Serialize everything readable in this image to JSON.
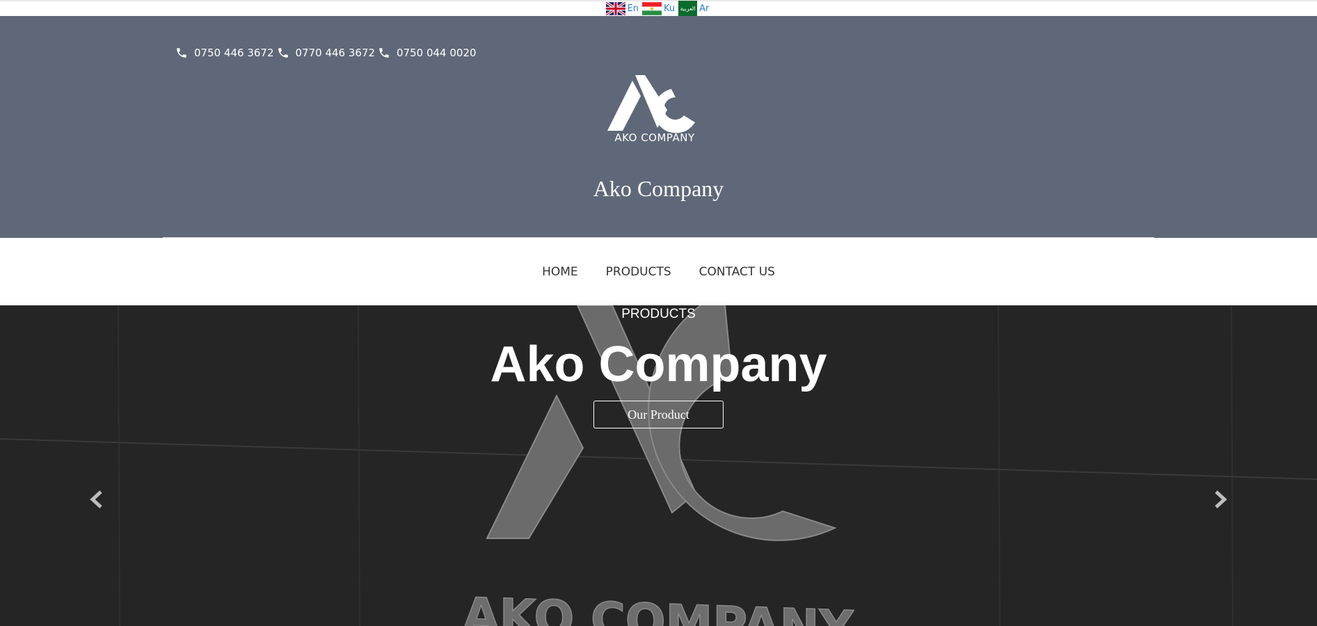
{
  "languages": [
    {
      "code_label": "En",
      "flag_icon": "uk-flag-icon"
    },
    {
      "code_label": "Ku",
      "flag_icon": "kurdistan-flag-icon"
    },
    {
      "code_label": "Ar",
      "flag_icon": "arabic-flag-icon",
      "flag_text": "العربية"
    }
  ],
  "header": {
    "phones": [
      "0750 446 3672",
      "0770 446 3672",
      "0750 044 0020"
    ],
    "logo_text": "AKO COMPANY",
    "site_title": "Ako Company",
    "background_color": "#5f6878"
  },
  "nav": {
    "items": [
      "HOME",
      "PRODUCTS",
      "CONTACT US"
    ]
  },
  "hero": {
    "kicker": "PRODUCTS",
    "title": "Ako Company",
    "button_label": "Our Product",
    "sign_text": "AKO COMPANY",
    "prev_icon": "chevron-left-icon",
    "next_icon": "chevron-right-icon"
  }
}
